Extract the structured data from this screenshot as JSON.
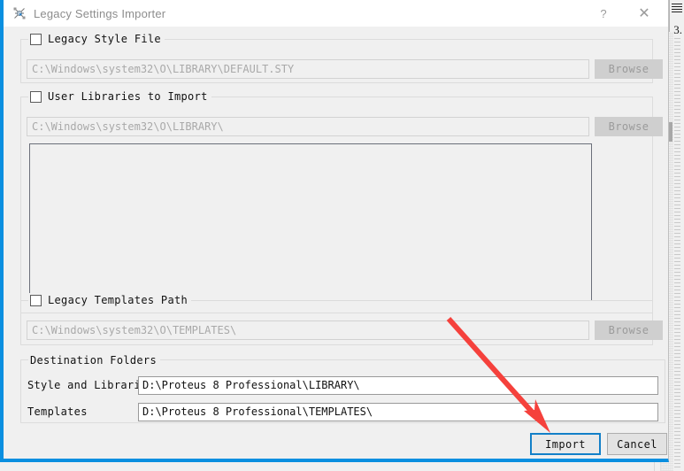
{
  "window": {
    "title": "Legacy Settings Importer",
    "icon": "proteus-app-icon",
    "help_label": "?",
    "close_label": "✕",
    "accent_color": "#0a8fe0"
  },
  "groups": {
    "legacy_style_file": {
      "legend": "Legacy Style File",
      "checked": false,
      "path_value": "C:\\Windows\\system32\\O\\LIBRARY\\DEFAULT.STY",
      "browse_label": "Browse",
      "browse_enabled": false
    },
    "user_libraries": {
      "legend": "User Libraries to Import",
      "checked": false,
      "path_value": "C:\\Windows\\system32\\O\\LIBRARY\\",
      "browse_label": "Browse",
      "browse_enabled": false,
      "list_items": []
    },
    "legacy_templates_path": {
      "legend": "Legacy Templates Path",
      "checked": false,
      "path_value": "C:\\Windows\\system32\\O\\TEMPLATES\\",
      "browse_label": "Browse",
      "browse_enabled": false
    },
    "destination_folders": {
      "legend": "Destination Folders",
      "rows": [
        {
          "label": "Style and Libraries",
          "value": "D:\\Proteus 8 Professional\\LIBRARY\\"
        },
        {
          "label": "Templates",
          "value": "D:\\Proteus 8 Professional\\TEMPLATES\\"
        }
      ]
    }
  },
  "footer": {
    "import_label": "Import",
    "cancel_label": "Cancel"
  },
  "annotation": {
    "arrow_color": "#f5413c",
    "points_to": "Import"
  },
  "backdrop": {
    "label": "3."
  }
}
